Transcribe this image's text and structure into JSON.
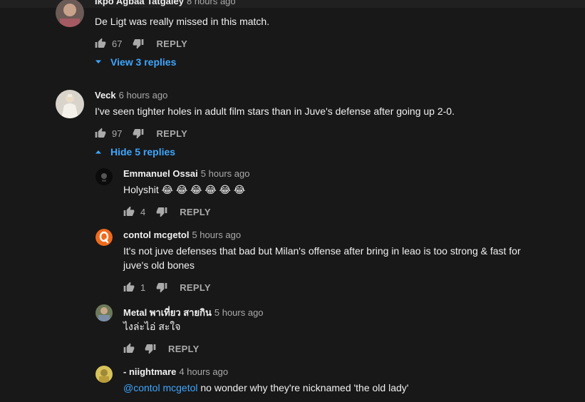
{
  "comments": [
    {
      "author": "Ikpo Agbaa Tatgaley",
      "time": "8 hours ago",
      "text": "De Ligt was really missed in this match.",
      "likes": "67",
      "reply_label": "REPLY",
      "replies_toggle": "View 3 replies"
    },
    {
      "author": "Veck",
      "time": "6 hours ago",
      "text": "I've seen tighter holes in adult film stars than in Juve's defense after going up 2-0.",
      "likes": "97",
      "reply_label": "REPLY",
      "replies_toggle": "Hide 5 replies"
    }
  ],
  "replies": [
    {
      "author": "Emmanuel Ossai",
      "time": "5 hours ago",
      "text": "Holyshit 😂 😂 😂 😂 😂 😂",
      "likes": "4",
      "reply_label": "REPLY"
    },
    {
      "author": "contol mcgetol",
      "time": "5 hours ago",
      "text": "It's not juve defenses that bad but Milan's offense after bring in leao is too strong & fast for juve's old bones",
      "likes": "1",
      "reply_label": "REPLY"
    },
    {
      "author": "Metal พาเที่ยว สายกิน",
      "time": "5 hours ago",
      "text": "ไงล่ะไอ่ สะใจ",
      "likes": "",
      "reply_label": "REPLY"
    },
    {
      "author": "- niightmare",
      "time": "4 hours ago",
      "mention": "@contol mcgetol",
      "text": " no wonder why they're nicknamed 'the old lady'"
    }
  ],
  "colors": {
    "background": "#181818",
    "link": "#3ea6ff",
    "muted": "#aaaaaa",
    "text": "#f1f1f1"
  },
  "icons": [
    "thumb-up-icon",
    "thumb-down-icon",
    "caret-down-icon",
    "caret-up-icon"
  ]
}
